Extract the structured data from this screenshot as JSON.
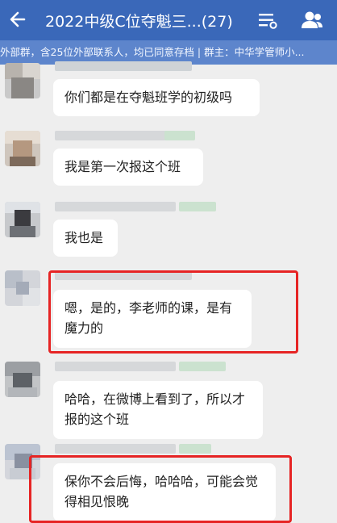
{
  "header": {
    "title": "2022中级C位夺魁三...(27)",
    "back_icon": "arrow-left-icon",
    "more_icon": "settings-lines-icon",
    "members_icon": "group-members-icon"
  },
  "notice": {
    "text": "外部群，含25位外部联系人，均已同意存档 | 群主：中华学管师小..."
  },
  "messages": [
    {
      "text": "你们都是在夺魁班学的初级吗"
    },
    {
      "text": "我是第一次报这个班"
    },
    {
      "text": "我也是"
    },
    {
      "text": "嗯，是的，李老师的课，是有魔力的",
      "highlighted": true
    },
    {
      "text": "哈哈，在微博上看到了，所以才报的这个班"
    },
    {
      "text": "保你不会后悔，哈哈哈，可能会觉得相见恨晚",
      "highlighted": true
    }
  ],
  "colors": {
    "header_bg": "#3a68b9",
    "notice_bg": "#5d85cc",
    "chat_bg": "#eeeeee",
    "highlight": "#e62424"
  }
}
